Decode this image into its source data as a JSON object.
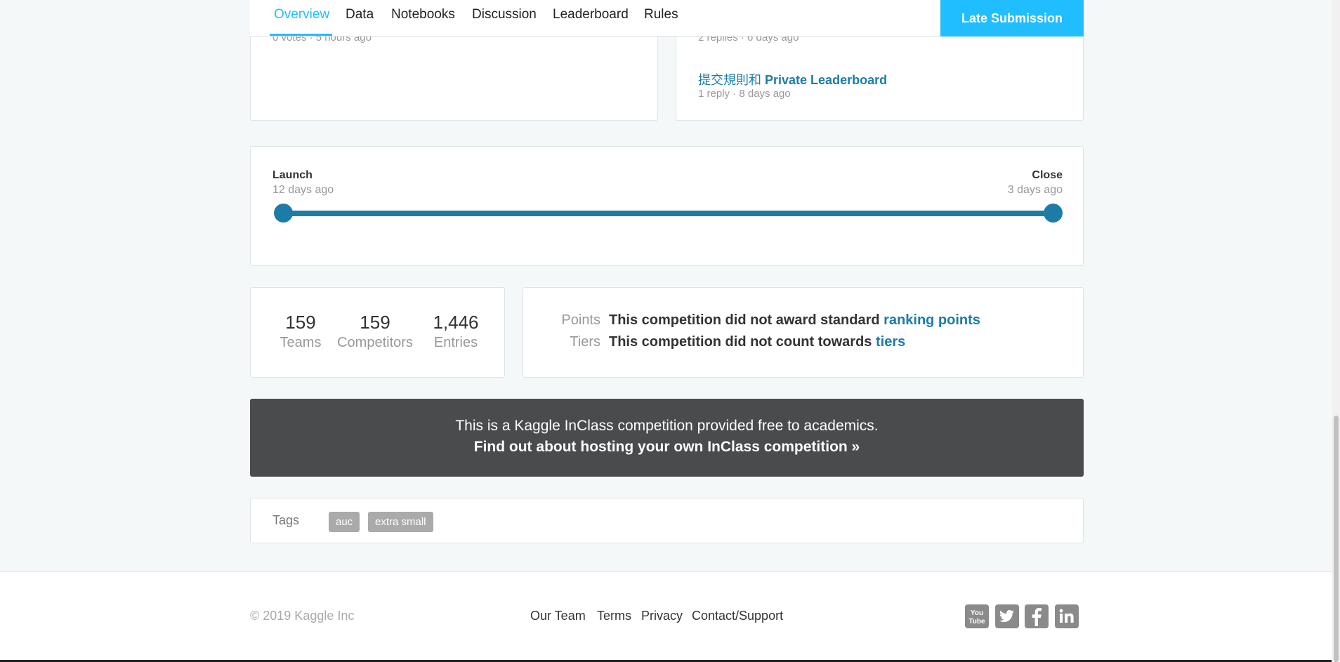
{
  "nav": {
    "tabs": [
      {
        "label": "Overview",
        "active": true
      },
      {
        "label": "Data"
      },
      {
        "label": "Notebooks"
      },
      {
        "label": "Discussion"
      },
      {
        "label": "Leaderboard"
      },
      {
        "label": "Rules"
      }
    ],
    "late_submission": "Late Submission"
  },
  "discussion": {
    "left_meta": "0 votes · 5 hours ago",
    "right_meta1": "2 replies · 6 days ago",
    "right_title_prefix": "提交規則和",
    "right_title_bold": "Private Leaderboard",
    "right_meta2": "1 reply · 8 days ago"
  },
  "timeline": {
    "launch_label": "Launch",
    "launch_time": "12 days ago",
    "close_label": "Close",
    "close_time": "3 days ago"
  },
  "stats": [
    {
      "value": "159",
      "label": "Teams"
    },
    {
      "value": "159",
      "label": "Competitors"
    },
    {
      "value": "1,446",
      "label": "Entries"
    }
  ],
  "points": {
    "points_key": "Points",
    "points_text": "This competition did not award standard",
    "points_link": "ranking points",
    "tiers_key": "Tiers",
    "tiers_text": "This competition did not count towards",
    "tiers_link": "tiers"
  },
  "banner": {
    "line1": "This is a Kaggle InClass competition provided free to academics.",
    "line2": "Find out about hosting your own InClass competition »"
  },
  "tags": {
    "label": "Tags",
    "items": [
      "auc",
      "extra small"
    ]
  },
  "footer": {
    "copyright": "© 2019 Kaggle Inc",
    "links": [
      "Our Team",
      "Terms",
      "Privacy",
      "Contact/Support"
    ],
    "social": [
      "youtube-icon",
      "twitter-icon",
      "facebook-icon",
      "linkedin-icon"
    ]
  },
  "colors": {
    "accent": "#20beff",
    "link": "#1d7ba8",
    "banner_bg": "#4a4b4d"
  }
}
